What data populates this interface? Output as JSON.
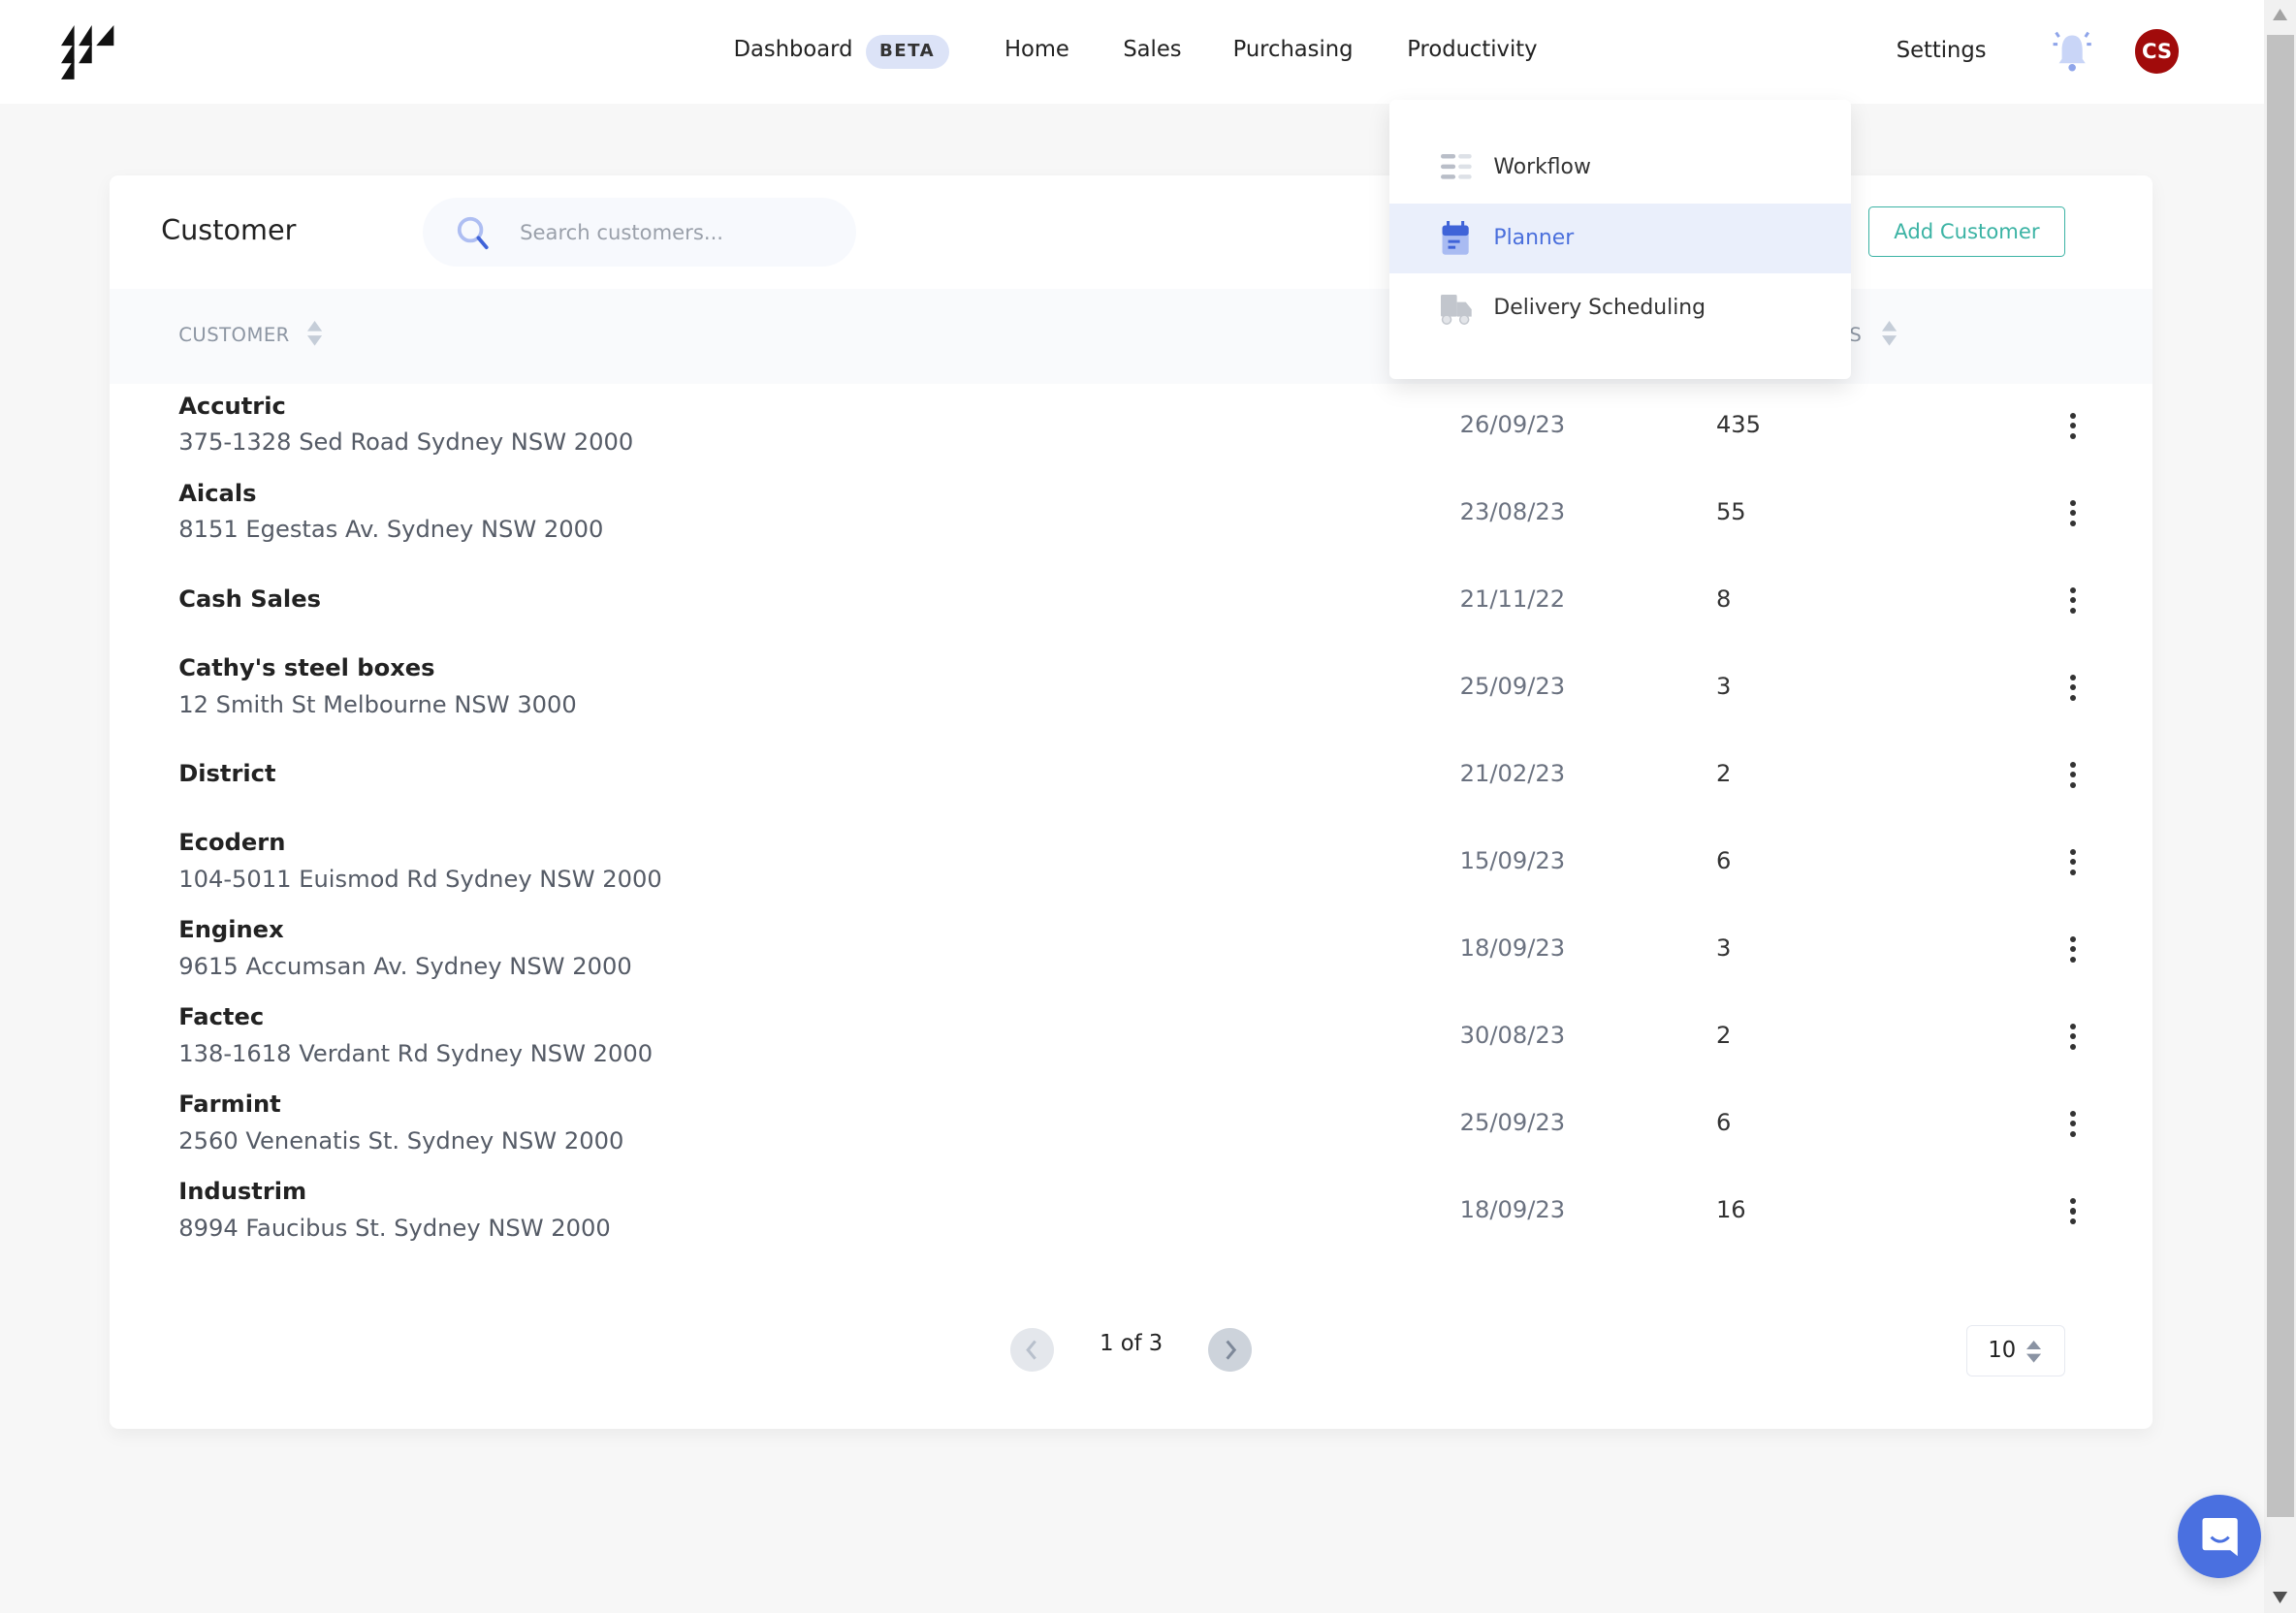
{
  "nav": {
    "items": [
      "Dashboard",
      "Home",
      "Sales",
      "Purchasing",
      "Productivity"
    ],
    "beta": "BETA",
    "settings": "Settings",
    "avatar": "CS"
  },
  "colors": {
    "accent": "#4a6fdc",
    "add_button": "#3bb3a4",
    "avatar": "#a10b0b"
  },
  "page": {
    "title": "Customer",
    "search_placeholder": "Search customers...",
    "add_label": "Add Customer"
  },
  "table": {
    "headers": {
      "customer": "CUSTOMER",
      "partial": "S"
    },
    "rows": [
      {
        "name": "Accutric",
        "address": "375-1328 Sed Road Sydney NSW 2000",
        "date": "26/09/23",
        "count": "435"
      },
      {
        "name": "Aicals",
        "address": "8151 Egestas Av. Sydney NSW 2000",
        "date": "23/08/23",
        "count": "55"
      },
      {
        "name": "Cash Sales",
        "address": "",
        "date": "21/11/22",
        "count": "8"
      },
      {
        "name": "Cathy's steel boxes",
        "address": "12 Smith St Melbourne NSW 3000",
        "date": "25/09/23",
        "count": "3"
      },
      {
        "name": "District",
        "address": "",
        "date": "21/02/23",
        "count": "2"
      },
      {
        "name": "Ecodern",
        "address": "104-5011 Euismod Rd Sydney NSW 2000",
        "date": "15/09/23",
        "count": "6"
      },
      {
        "name": "Enginex",
        "address": "9615 Accumsan Av. Sydney NSW 2000",
        "date": "18/09/23",
        "count": "3"
      },
      {
        "name": "Factec",
        "address": "138-1618 Verdant Rd Sydney NSW 2000",
        "date": "30/08/23",
        "count": "2"
      },
      {
        "name": "Farmint",
        "address": "2560 Venenatis St. Sydney NSW 2000",
        "date": "25/09/23",
        "count": "6"
      },
      {
        "name": "Industrim",
        "address": "8994 Faucibus St. Sydney NSW 2000",
        "date": "18/09/23",
        "count": "16"
      }
    ]
  },
  "pagination": {
    "text": "1 of 3",
    "per_page": "10"
  },
  "menu": {
    "items": [
      {
        "label": "Workflow",
        "icon": "list-icon"
      },
      {
        "label": "Planner",
        "icon": "calendar-icon",
        "active": true
      },
      {
        "label": "Delivery Scheduling",
        "icon": "truck-icon"
      }
    ]
  }
}
